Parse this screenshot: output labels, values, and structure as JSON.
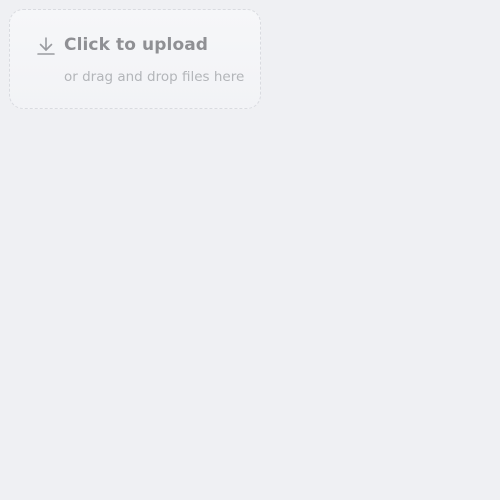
{
  "upload": {
    "icon": "download-arrow-icon",
    "title": "Click to upload",
    "subtitle": "or drag and drop files here"
  }
}
